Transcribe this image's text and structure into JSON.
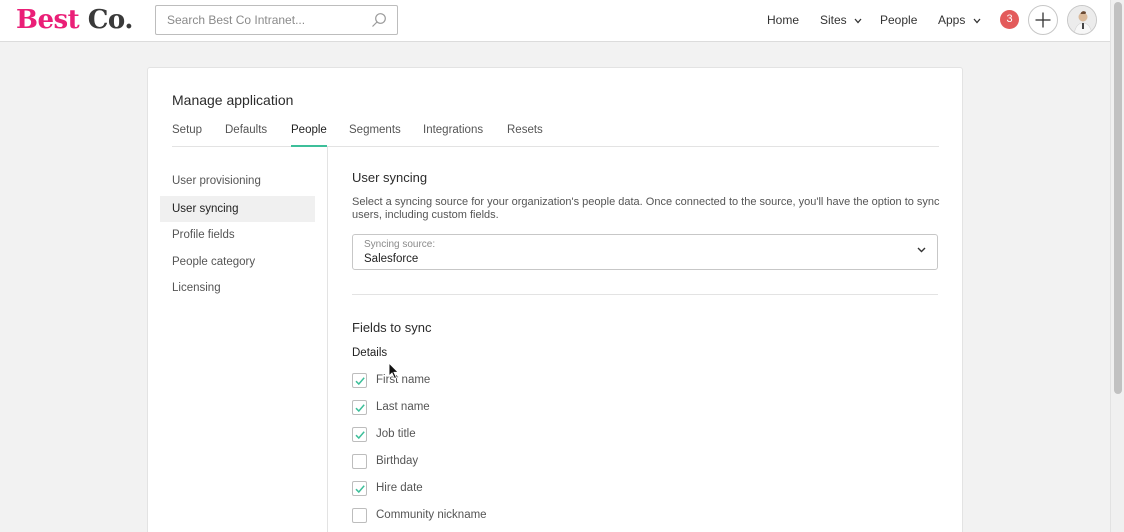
{
  "header": {
    "logo": {
      "part1": "Best",
      "part2": "Co."
    },
    "search_placeholder": "Search Best Co Intranet...",
    "nav": [
      {
        "label": "Home",
        "has_dropdown": false
      },
      {
        "label": "Sites",
        "has_dropdown": true
      },
      {
        "label": "People",
        "has_dropdown": false
      },
      {
        "label": "Apps",
        "has_dropdown": true
      }
    ],
    "notification_count": "3",
    "icons": {
      "search": "search-icon",
      "add": "plus-icon",
      "avatar": "user-avatar"
    }
  },
  "page": {
    "title": "Manage application",
    "tabs": [
      {
        "label": "Setup",
        "active": false
      },
      {
        "label": "Defaults",
        "active": false
      },
      {
        "label": "People",
        "active": true
      },
      {
        "label": "Segments",
        "active": false
      },
      {
        "label": "Integrations",
        "active": false
      },
      {
        "label": "Resets",
        "active": false
      }
    ],
    "subnav": [
      {
        "label": "User provisioning",
        "active": false
      },
      {
        "label": "User syncing",
        "active": true
      },
      {
        "label": "Profile fields",
        "active": false
      },
      {
        "label": "People category",
        "active": false
      },
      {
        "label": "Licensing",
        "active": false
      }
    ]
  },
  "syncing": {
    "title": "User syncing",
    "description": "Select a syncing source for your organization's people data. Once connected to the source, you'll have the option to sync users, including custom fields.",
    "source_label": "Syncing source:",
    "source_value": "Salesforce"
  },
  "fields": {
    "title": "Fields to sync",
    "group_label": "Details",
    "items": [
      {
        "label": "First name",
        "checked": true
      },
      {
        "label": "Last name",
        "checked": true
      },
      {
        "label": "Job title",
        "checked": true
      },
      {
        "label": "Birthday",
        "checked": false
      },
      {
        "label": "Hire date",
        "checked": true
      },
      {
        "label": "Community nickname",
        "checked": false
      }
    ]
  },
  "colors": {
    "brand_pink": "#ea1f77",
    "accent_teal": "#3dbf9a",
    "badge_red": "#e35b5b"
  }
}
